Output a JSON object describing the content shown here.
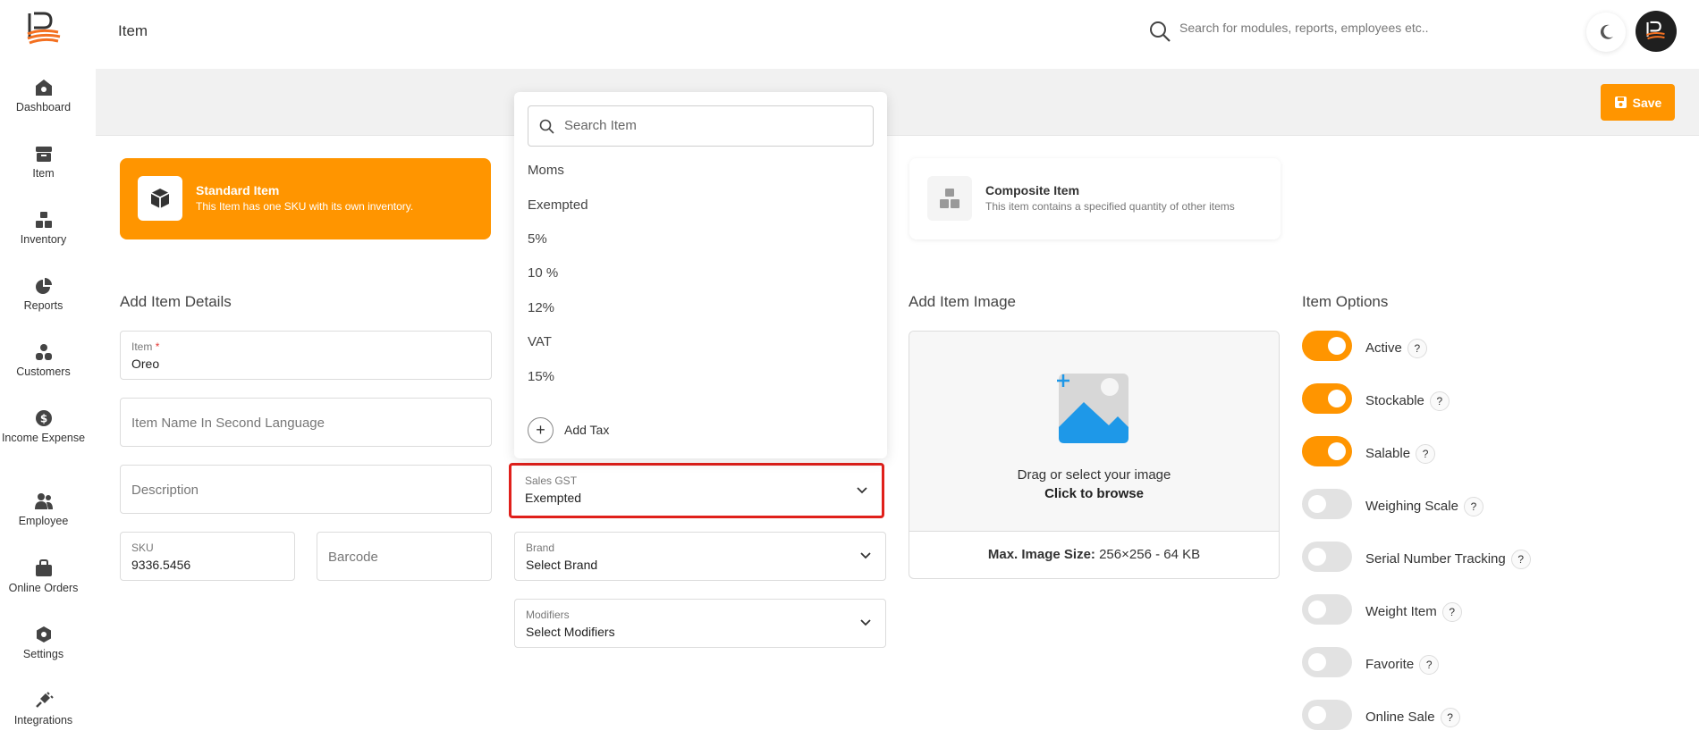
{
  "app": {
    "logo_label": "IP"
  },
  "sidebar": {
    "items": [
      {
        "label": "Dashboard",
        "icon": "dashboard-icon"
      },
      {
        "label": "Item",
        "icon": "item-box-icon"
      },
      {
        "label": "Inventory",
        "icon": "inventory-icon"
      },
      {
        "label": "Reports",
        "icon": "pie-chart-icon"
      },
      {
        "label": "Customers",
        "icon": "customers-icon"
      },
      {
        "label": "Income Expense",
        "icon": "dollar-icon"
      },
      {
        "label": "Employee",
        "icon": "employee-icon"
      },
      {
        "label": "Online Orders",
        "icon": "bag-icon"
      },
      {
        "label": "Settings",
        "icon": "gear-icon"
      },
      {
        "label": "Integrations",
        "icon": "plug-icon"
      }
    ]
  },
  "header": {
    "title": "Item",
    "search_placeholder": "Search for modules, reports, employees etc.."
  },
  "toolbar": {
    "save_label": "Save"
  },
  "item_types": {
    "standard": {
      "title": "Standard Item",
      "desc": "This Item has one SKU with its own inventory."
    },
    "composite": {
      "title": "Composite Item",
      "desc": "This item contains a specified quantity of other items"
    }
  },
  "details": {
    "section_title": "Add Item Details",
    "item_label": "Item",
    "required_mark": "*",
    "item_value": "Oreo",
    "second_lang_placeholder": "Item Name In Second Language",
    "description_placeholder": "Description",
    "sku_label": "SKU",
    "sku_value": "9336.5456",
    "barcode_placeholder": "Barcode"
  },
  "dropdown": {
    "search_placeholder": "Search Item",
    "options": [
      "Moms",
      "Exempted",
      "5%",
      "10 %",
      "12%",
      "VAT",
      "15%"
    ],
    "add_label": "Add Tax"
  },
  "selects": {
    "sales_gst": {
      "label": "Sales GST",
      "value": "Exempted"
    },
    "brand": {
      "label": "Brand",
      "value": "Select Brand"
    },
    "modifiers": {
      "label": "Modifiers",
      "value": "Select Modifiers"
    }
  },
  "image": {
    "section_title": "Add Item Image",
    "drag_text": "Drag or select your image",
    "browse_text": "Click to browse",
    "max_label": "Max. Image Size:",
    "max_value": "256×256 - 64 KB"
  },
  "options": {
    "section_title": "Item Options",
    "help_mark": "?",
    "items": [
      {
        "label": "Active",
        "on": true
      },
      {
        "label": "Stockable",
        "on": true
      },
      {
        "label": "Salable",
        "on": true
      },
      {
        "label": "Weighing Scale",
        "on": false
      },
      {
        "label": "Serial Number Tracking",
        "on": false
      },
      {
        "label": "Weight Item",
        "on": false
      },
      {
        "label": "Favorite",
        "on": false
      },
      {
        "label": "Online Sale",
        "on": false
      }
    ]
  },
  "colors": {
    "accent": "#ff9500",
    "highlight": "#e0201b"
  }
}
